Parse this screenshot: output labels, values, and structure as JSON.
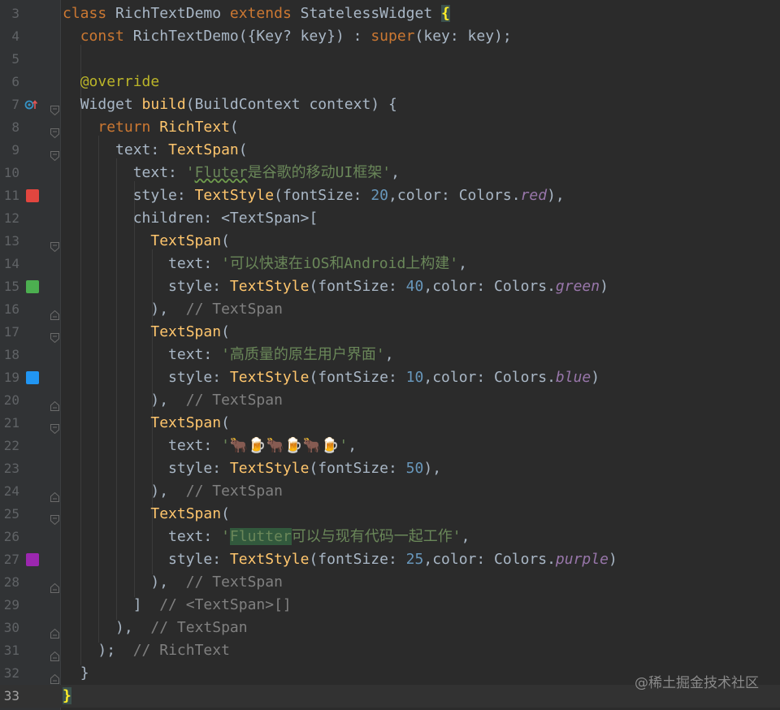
{
  "editor": {
    "lines": [
      {
        "n": "3",
        "parts": [
          [
            "kw",
            "class "
          ],
          [
            "cls",
            "RichTextDemo "
          ],
          [
            "kw",
            "extends "
          ],
          [
            "cls",
            "StatelessWidget "
          ],
          [
            "brace",
            "{"
          ]
        ]
      },
      {
        "n": "4",
        "parts": [
          [
            "",
            "  "
          ],
          [
            "kw",
            "const "
          ],
          [
            "cls",
            "RichTextDemo({Key? key}) : "
          ],
          [
            "kw",
            "super"
          ],
          [
            "cls",
            "(key: key);"
          ]
        ]
      },
      {
        "n": "5",
        "parts": []
      },
      {
        "n": "6",
        "parts": [
          [
            "",
            "  "
          ],
          [
            "ann",
            "@override"
          ]
        ]
      },
      {
        "n": "7",
        "parts": [
          [
            "",
            "  "
          ],
          [
            "cls",
            "Widget "
          ],
          [
            "fn",
            "build"
          ],
          [
            "cls",
            "(BuildContext context) {"
          ]
        ]
      },
      {
        "n": "8",
        "parts": [
          [
            "",
            "    "
          ],
          [
            "kw",
            "return "
          ],
          [
            "fn",
            "RichText"
          ],
          [
            "cls",
            "("
          ]
        ]
      },
      {
        "n": "9",
        "parts": [
          [
            "",
            "      "
          ],
          [
            "cls",
            "text: "
          ],
          [
            "fn",
            "TextSpan"
          ],
          [
            "cls",
            "("
          ]
        ]
      },
      {
        "n": "10",
        "parts": [
          [
            "",
            "        "
          ],
          [
            "cls",
            "text: "
          ],
          [
            "str",
            "'"
          ],
          [
            "typo",
            "Fluter"
          ],
          [
            "str",
            "是谷歌的移动UI框架'"
          ],
          [
            "cls",
            ","
          ]
        ]
      },
      {
        "n": "11",
        "parts": [
          [
            "",
            "        "
          ],
          [
            "cls",
            "style: "
          ],
          [
            "fn",
            "TextStyle"
          ],
          [
            "cls",
            "(fontSize: "
          ],
          [
            "num",
            "20"
          ],
          [
            "cls",
            ",color: Colors."
          ],
          [
            "prop",
            "red"
          ],
          [
            "cls",
            "),"
          ]
        ]
      },
      {
        "n": "12",
        "parts": [
          [
            "",
            "        "
          ],
          [
            "cls",
            "children: <TextSpan>["
          ]
        ]
      },
      {
        "n": "13",
        "parts": [
          [
            "",
            "          "
          ],
          [
            "fn",
            "TextSpan"
          ],
          [
            "cls",
            "("
          ]
        ]
      },
      {
        "n": "14",
        "parts": [
          [
            "",
            "            "
          ],
          [
            "cls",
            "text: "
          ],
          [
            "str",
            "'可以快速在iOS和Android上构建'"
          ],
          [
            "cls",
            ","
          ]
        ]
      },
      {
        "n": "15",
        "parts": [
          [
            "",
            "            "
          ],
          [
            "cls",
            "style: "
          ],
          [
            "fn",
            "TextStyle"
          ],
          [
            "cls",
            "(fontSize: "
          ],
          [
            "num",
            "40"
          ],
          [
            "cls",
            ",color: Colors."
          ],
          [
            "prop",
            "green"
          ],
          [
            "cls",
            ")"
          ]
        ]
      },
      {
        "n": "16",
        "parts": [
          [
            "",
            "          "
          ],
          [
            "cls",
            "),  "
          ],
          [
            "cmt",
            "// TextSpan"
          ]
        ]
      },
      {
        "n": "17",
        "parts": [
          [
            "",
            "          "
          ],
          [
            "fn",
            "TextSpan"
          ],
          [
            "cls",
            "("
          ]
        ]
      },
      {
        "n": "18",
        "parts": [
          [
            "",
            "            "
          ],
          [
            "cls",
            "text: "
          ],
          [
            "str",
            "'高质量的原生用户界面'"
          ],
          [
            "cls",
            ","
          ]
        ]
      },
      {
        "n": "19",
        "parts": [
          [
            "",
            "            "
          ],
          [
            "cls",
            "style: "
          ],
          [
            "fn",
            "TextStyle"
          ],
          [
            "cls",
            "(fontSize: "
          ],
          [
            "num",
            "10"
          ],
          [
            "cls",
            ",color: Colors."
          ],
          [
            "prop",
            "blue"
          ],
          [
            "cls",
            ")"
          ]
        ]
      },
      {
        "n": "20",
        "parts": [
          [
            "",
            "          "
          ],
          [
            "cls",
            "),  "
          ],
          [
            "cmt",
            "// TextSpan"
          ]
        ]
      },
      {
        "n": "21",
        "parts": [
          [
            "",
            "          "
          ],
          [
            "fn",
            "TextSpan"
          ],
          [
            "cls",
            "("
          ]
        ]
      },
      {
        "n": "22",
        "parts": [
          [
            "",
            "            "
          ],
          [
            "cls",
            "text: "
          ],
          [
            "str",
            "'🐂🍺🐂🍺🐂🍺'"
          ],
          [
            "cls",
            ","
          ]
        ]
      },
      {
        "n": "23",
        "parts": [
          [
            "",
            "            "
          ],
          [
            "cls",
            "style: "
          ],
          [
            "fn",
            "TextStyle"
          ],
          [
            "cls",
            "(fontSize: "
          ],
          [
            "num",
            "50"
          ],
          [
            "cls",
            "),"
          ]
        ]
      },
      {
        "n": "24",
        "parts": [
          [
            "",
            "          "
          ],
          [
            "cls",
            "),  "
          ],
          [
            "cmt",
            "// TextSpan"
          ]
        ]
      },
      {
        "n": "25",
        "parts": [
          [
            "",
            "          "
          ],
          [
            "fn",
            "TextSpan"
          ],
          [
            "cls",
            "("
          ]
        ]
      },
      {
        "n": "26",
        "parts": [
          [
            "",
            "            "
          ],
          [
            "cls",
            "text: "
          ],
          [
            "str",
            "'"
          ],
          [
            "sel",
            "Flutter"
          ],
          [
            "str",
            "可以与现有代码一起工作'"
          ],
          [
            "cls",
            ","
          ]
        ]
      },
      {
        "n": "27",
        "parts": [
          [
            "",
            "            "
          ],
          [
            "cls",
            "style: "
          ],
          [
            "fn",
            "TextStyle"
          ],
          [
            "cls",
            "(fontSize: "
          ],
          [
            "num",
            "25"
          ],
          [
            "cls",
            ",color: Colors."
          ],
          [
            "prop",
            "purple"
          ],
          [
            "cls",
            ")"
          ]
        ]
      },
      {
        "n": "28",
        "parts": [
          [
            "",
            "          "
          ],
          [
            "cls",
            "),  "
          ],
          [
            "cmt",
            "// TextSpan"
          ]
        ]
      },
      {
        "n": "29",
        "parts": [
          [
            "",
            "        "
          ],
          [
            "cls",
            "]  "
          ],
          [
            "cmt",
            "// <TextSpan>[]"
          ]
        ]
      },
      {
        "n": "30",
        "parts": [
          [
            "",
            "      "
          ],
          [
            "cls",
            "),  "
          ],
          [
            "cmt",
            "// TextSpan"
          ]
        ]
      },
      {
        "n": "31",
        "parts": [
          [
            "",
            "    "
          ],
          [
            "cls",
            ");  "
          ],
          [
            "cmt",
            "// RichText"
          ]
        ]
      },
      {
        "n": "32",
        "parts": [
          [
            "",
            "  "
          ],
          [
            "cls",
            "}"
          ]
        ]
      },
      {
        "n": "33",
        "parts": [
          [
            "brace",
            "}"
          ]
        ]
      }
    ],
    "current_line": "33",
    "swatches": {
      "11": "#e2463f",
      "15": "#4caf50",
      "19": "#2196f3",
      "27": "#9c27b0"
    },
    "override_marker_line": "7",
    "override_marker_icon": "override-method-icon",
    "fold_lines": {
      "7": "open",
      "8": "open",
      "9": "open",
      "13": "open",
      "16": "close",
      "17": "open",
      "20": "close",
      "21": "open",
      "24": "close",
      "25": "open",
      "28": "close",
      "30": "close",
      "31": "close",
      "32": "close"
    }
  },
  "colors": {
    "background": "#2b2b2b",
    "gutter": "#313335",
    "keyword": "#cc7832",
    "function": "#ffc66d",
    "string": "#6a8759",
    "number": "#6897bb",
    "comment": "#808080"
  },
  "watermark": "@稀土掘金技术社区"
}
